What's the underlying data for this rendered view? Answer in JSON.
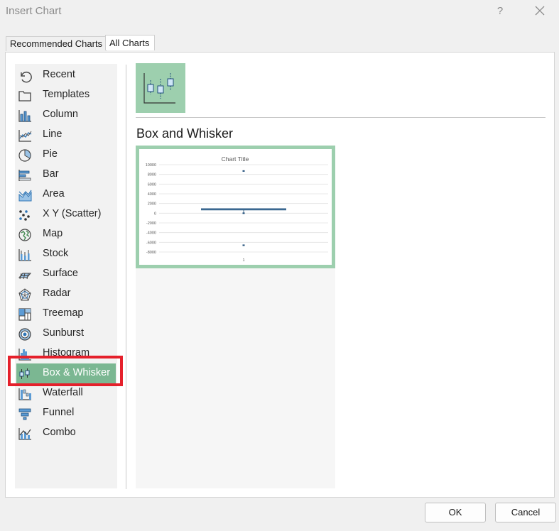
{
  "dialog": {
    "title": "Insert Chart",
    "help_label": "?"
  },
  "tabs": [
    {
      "label": "Recommended Charts",
      "active": false
    },
    {
      "label": "All Charts",
      "active": true
    }
  ],
  "sidebar": {
    "items": [
      {
        "label": "Recent",
        "icon": "recent-icon"
      },
      {
        "label": "Templates",
        "icon": "templates-icon"
      },
      {
        "label": "Column",
        "icon": "column-chart-icon"
      },
      {
        "label": "Line",
        "icon": "line-chart-icon"
      },
      {
        "label": "Pie",
        "icon": "pie-chart-icon"
      },
      {
        "label": "Bar",
        "icon": "bar-chart-icon"
      },
      {
        "label": "Area",
        "icon": "area-chart-icon"
      },
      {
        "label": "X Y (Scatter)",
        "icon": "scatter-chart-icon"
      },
      {
        "label": "Map",
        "icon": "map-chart-icon"
      },
      {
        "label": "Stock",
        "icon": "stock-chart-icon"
      },
      {
        "label": "Surface",
        "icon": "surface-chart-icon"
      },
      {
        "label": "Radar",
        "icon": "radar-chart-icon"
      },
      {
        "label": "Treemap",
        "icon": "treemap-chart-icon"
      },
      {
        "label": "Sunburst",
        "icon": "sunburst-chart-icon"
      },
      {
        "label": "Histogram",
        "icon": "histogram-chart-icon"
      },
      {
        "label": "Box & Whisker",
        "icon": "box-whisker-chart-icon",
        "selected": true
      },
      {
        "label": "Waterfall",
        "icon": "waterfall-chart-icon"
      },
      {
        "label": "Funnel",
        "icon": "funnel-chart-icon"
      },
      {
        "label": "Combo",
        "icon": "combo-chart-icon"
      }
    ],
    "selected_color": "#7bb792",
    "highlight_color": "#e5202b"
  },
  "main": {
    "type_title": "Box and Whisker",
    "accent_color": "#9dcfae"
  },
  "preview": {
    "chart_data": {
      "type": "box",
      "title": "Chart Title",
      "categories": [
        "1"
      ],
      "ylim": [
        -8000,
        10000
      ],
      "yticks": [
        "10000",
        "8000",
        "6000",
        "4000",
        "2000",
        "0",
        "-2000",
        "-4000",
        "-6000",
        "-8000"
      ],
      "box": {
        "q1": 600,
        "median": 800,
        "q3": 1000,
        "whisker_low": 0,
        "whisker_high": 1000
      },
      "outliers": [
        8700,
        0,
        -6600
      ],
      "grid": true
    }
  },
  "buttons": {
    "ok": "OK",
    "cancel": "Cancel"
  }
}
